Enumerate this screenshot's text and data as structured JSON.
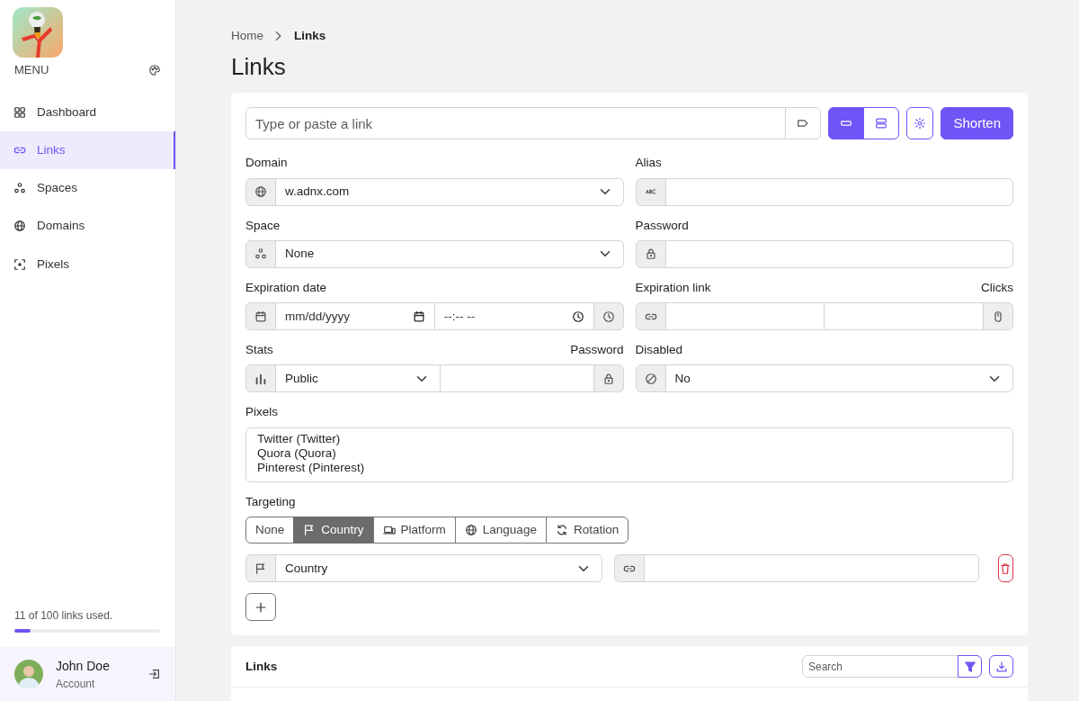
{
  "sidebar": {
    "menu_label": "MENU",
    "items": [
      {
        "label": "Dashboard",
        "selected": false
      },
      {
        "label": "Links",
        "selected": true
      },
      {
        "label": "Spaces",
        "selected": false
      },
      {
        "label": "Domains",
        "selected": false
      },
      {
        "label": "Pixels",
        "selected": false
      }
    ],
    "usage": {
      "text": "11 of 100 links used.",
      "level": 0.11
    },
    "user": {
      "name": "John Doe",
      "subtitle": "Account"
    }
  },
  "breadcrumb": [
    {
      "label": "Home"
    },
    {
      "label": "Links"
    }
  ],
  "title": "Links",
  "form": {
    "link_placeholder": "Type or paste a link",
    "view_modes": [
      {
        "selected": true
      },
      {
        "selected": false
      }
    ],
    "shorten_button": "Shorten",
    "domain": {
      "label": "Domain",
      "value": "w.adnx.com"
    },
    "alias": {
      "label": "Alias"
    },
    "space": {
      "label": "Space",
      "value": "None"
    },
    "password": {
      "label": "Password"
    },
    "expiration_date": {
      "label": "Expiration date",
      "date_placeholder": "mm/dd/yyyy",
      "time_placeholder": "--:-- --"
    },
    "expiration_link": {
      "label": "Expiration link",
      "clicks_label": "Clicks"
    },
    "stats": {
      "label": "Stats",
      "value": "Public",
      "password_label": "Password"
    },
    "disabled": {
      "label": "Disabled",
      "value": "No"
    },
    "pixels": {
      "label": "Pixels",
      "options": [
        "Twitter (Twitter)",
        "Quora (Quora)",
        "Pinterest (Pinterest)"
      ]
    },
    "targeting": {
      "label": "Targeting",
      "options": [
        {
          "label": "None",
          "selected": false
        },
        {
          "label": "Country",
          "selected": true
        },
        {
          "label": "Platform",
          "selected": false
        },
        {
          "label": "Language",
          "selected": false
        },
        {
          "label": "Rotation",
          "selected": false
        }
      ],
      "rule_value": "Country"
    }
  },
  "links_panel": {
    "title": "Links",
    "search_placeholder": "Search"
  }
}
